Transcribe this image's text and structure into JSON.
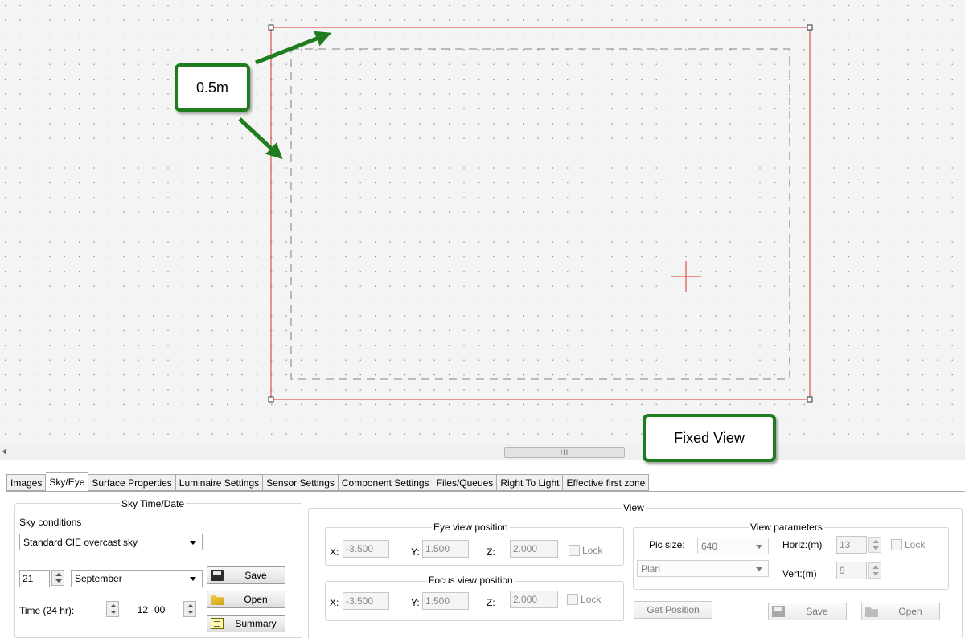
{
  "canvas": {
    "annotations": {
      "callout_dimension": "0.5m",
      "callout_fixed_view": "Fixed View"
    },
    "colors": {
      "background": "#f4f4f4",
      "room_outline": "#e05050",
      "dashed_outline": "#9a9a9a",
      "annotation_green": "#1f7d1f"
    }
  },
  "scrollbar": {
    "thumb_grip": "III"
  },
  "tabs": [
    {
      "label": "Images"
    },
    {
      "label": "Sky/Eye"
    },
    {
      "label": "Surface Properties"
    },
    {
      "label": "Luminaire Settings"
    },
    {
      "label": "Sensor Settings"
    },
    {
      "label": "Component Settings"
    },
    {
      "label": "Files/Queues"
    },
    {
      "label": "Right To Light"
    },
    {
      "label": "Effective first zone"
    }
  ],
  "sky_time_date": {
    "group_title": "Sky Time/Date",
    "sky_conditions_label": "Sky conditions",
    "sky_conditions_value": "Standard CIE overcast sky",
    "day_value": "21",
    "month_value": "September",
    "time_label": "Time (24 hr):",
    "hour_value": "12",
    "minute_value": "00",
    "save_label": "Save",
    "open_label": "Open",
    "summary_label": "Summary"
  },
  "view": {
    "group_title": "View",
    "eye": {
      "title": "Eye view position",
      "x_label": "X:",
      "x_value": "-3.500",
      "y_label": "Y:",
      "y_value": "1.500",
      "z_label": "Z:",
      "z_value": "2.000",
      "lock_label": "Lock"
    },
    "focus": {
      "title": "Focus view position",
      "x_label": "X:",
      "x_value": "-3.500",
      "y_label": "Y:",
      "y_value": "1.500",
      "z_label": "Z:",
      "z_value": "2.000",
      "lock_label": "Lock"
    },
    "params": {
      "title": "View parameters",
      "pic_size_label": "Pic size:",
      "pic_size_value": "640",
      "view_type_value": "Plan",
      "horiz_label": "Horiz:(m)",
      "horiz_value": "13",
      "vert_label": "Vert:(m)",
      "vert_value": "9",
      "lock_label": "Lock"
    },
    "get_position_label": "Get Position",
    "save_label": "Save",
    "open_label": "Open"
  }
}
